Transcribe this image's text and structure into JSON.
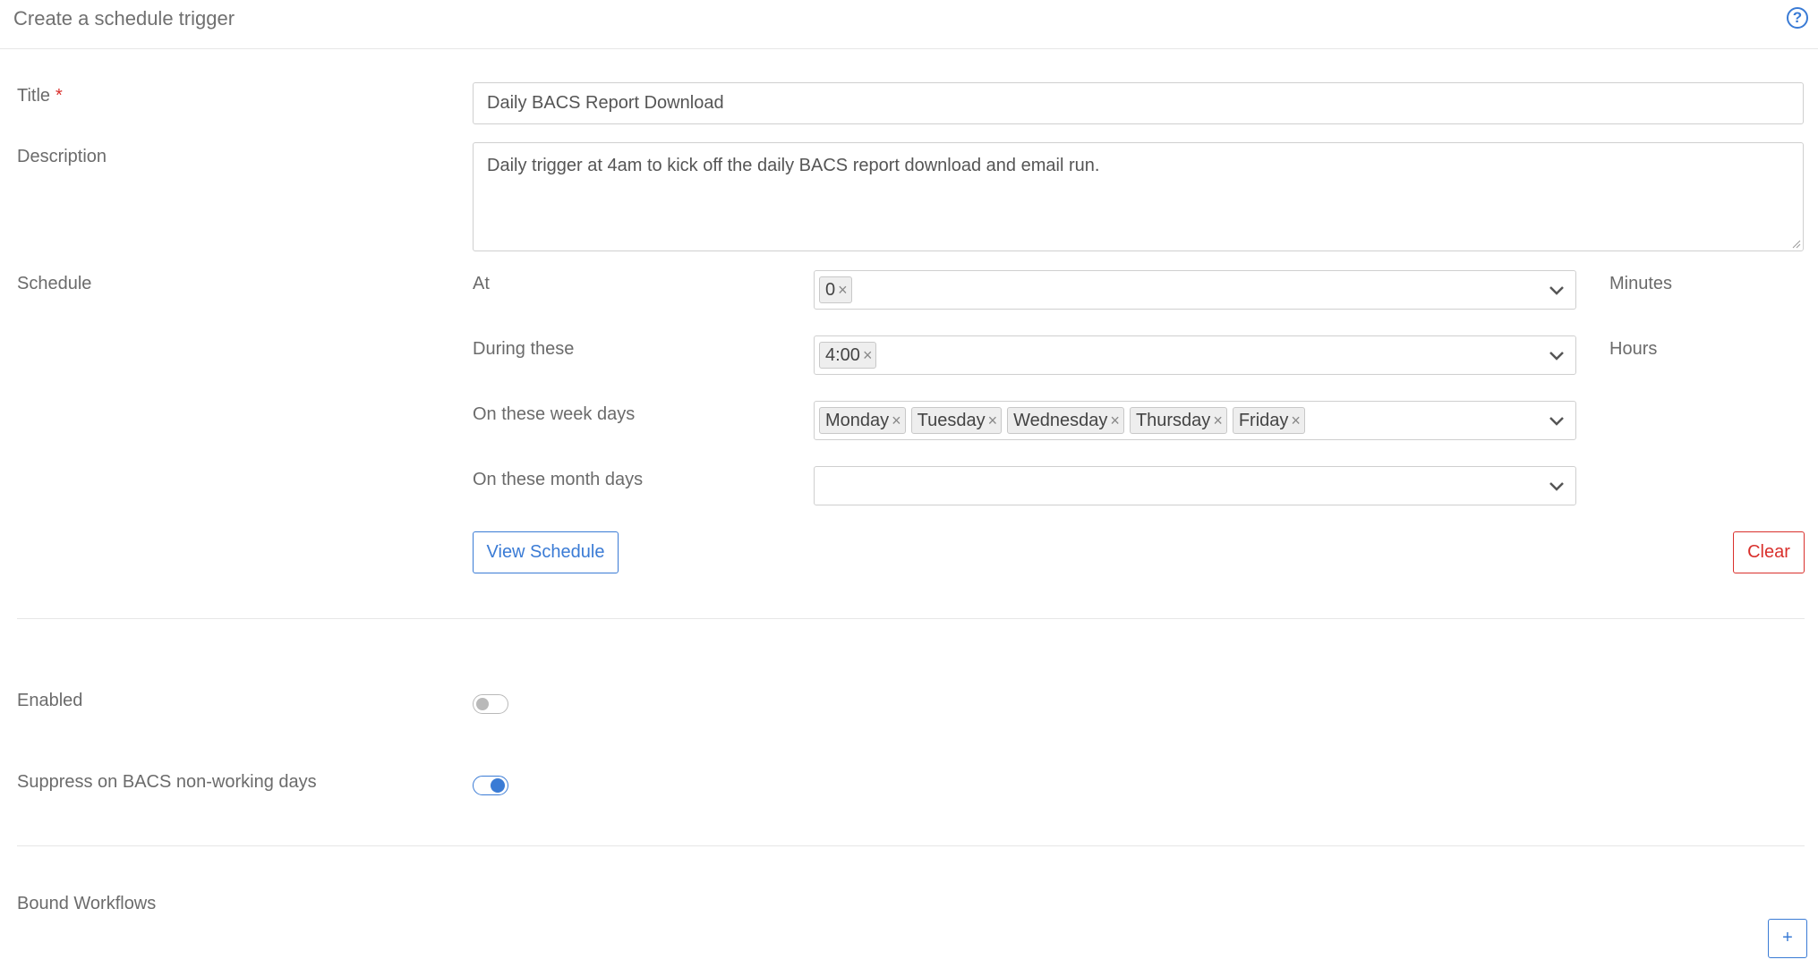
{
  "header": {
    "title": "Create a schedule trigger",
    "help_icon": "question-circle-icon"
  },
  "form": {
    "title_label": "Title",
    "required_marker": "*",
    "title_value": "Daily BACS Report Download",
    "description_label": "Description",
    "description_value": "Daily trigger at 4am to kick off the daily BACS report download and email run.",
    "schedule_label": "Schedule"
  },
  "schedule": {
    "minutes": {
      "label": "At",
      "values": [
        "0"
      ],
      "unit": "Minutes"
    },
    "hours": {
      "label": "During these",
      "values": [
        "4:00"
      ],
      "unit": "Hours"
    },
    "week_days": {
      "label": "On these week days",
      "values": [
        "Monday",
        "Tuesday",
        "Wednesday",
        "Thursday",
        "Friday"
      ]
    },
    "month_days": {
      "label": "On these month days",
      "values": []
    },
    "remove_glyph": "×",
    "view_button": "View Schedule",
    "clear_button": "Clear"
  },
  "settings": {
    "enabled_label": "Enabled",
    "enabled": false,
    "suppress_label": "Suppress on BACS non-working days",
    "suppress": true
  },
  "workflows": {
    "label": "Bound Workflows",
    "add_button": "+"
  },
  "colors": {
    "accent": "#3a7bd5",
    "danger": "#d9302c",
    "text": "#6b6b6b",
    "border": "#cfcfcf"
  }
}
